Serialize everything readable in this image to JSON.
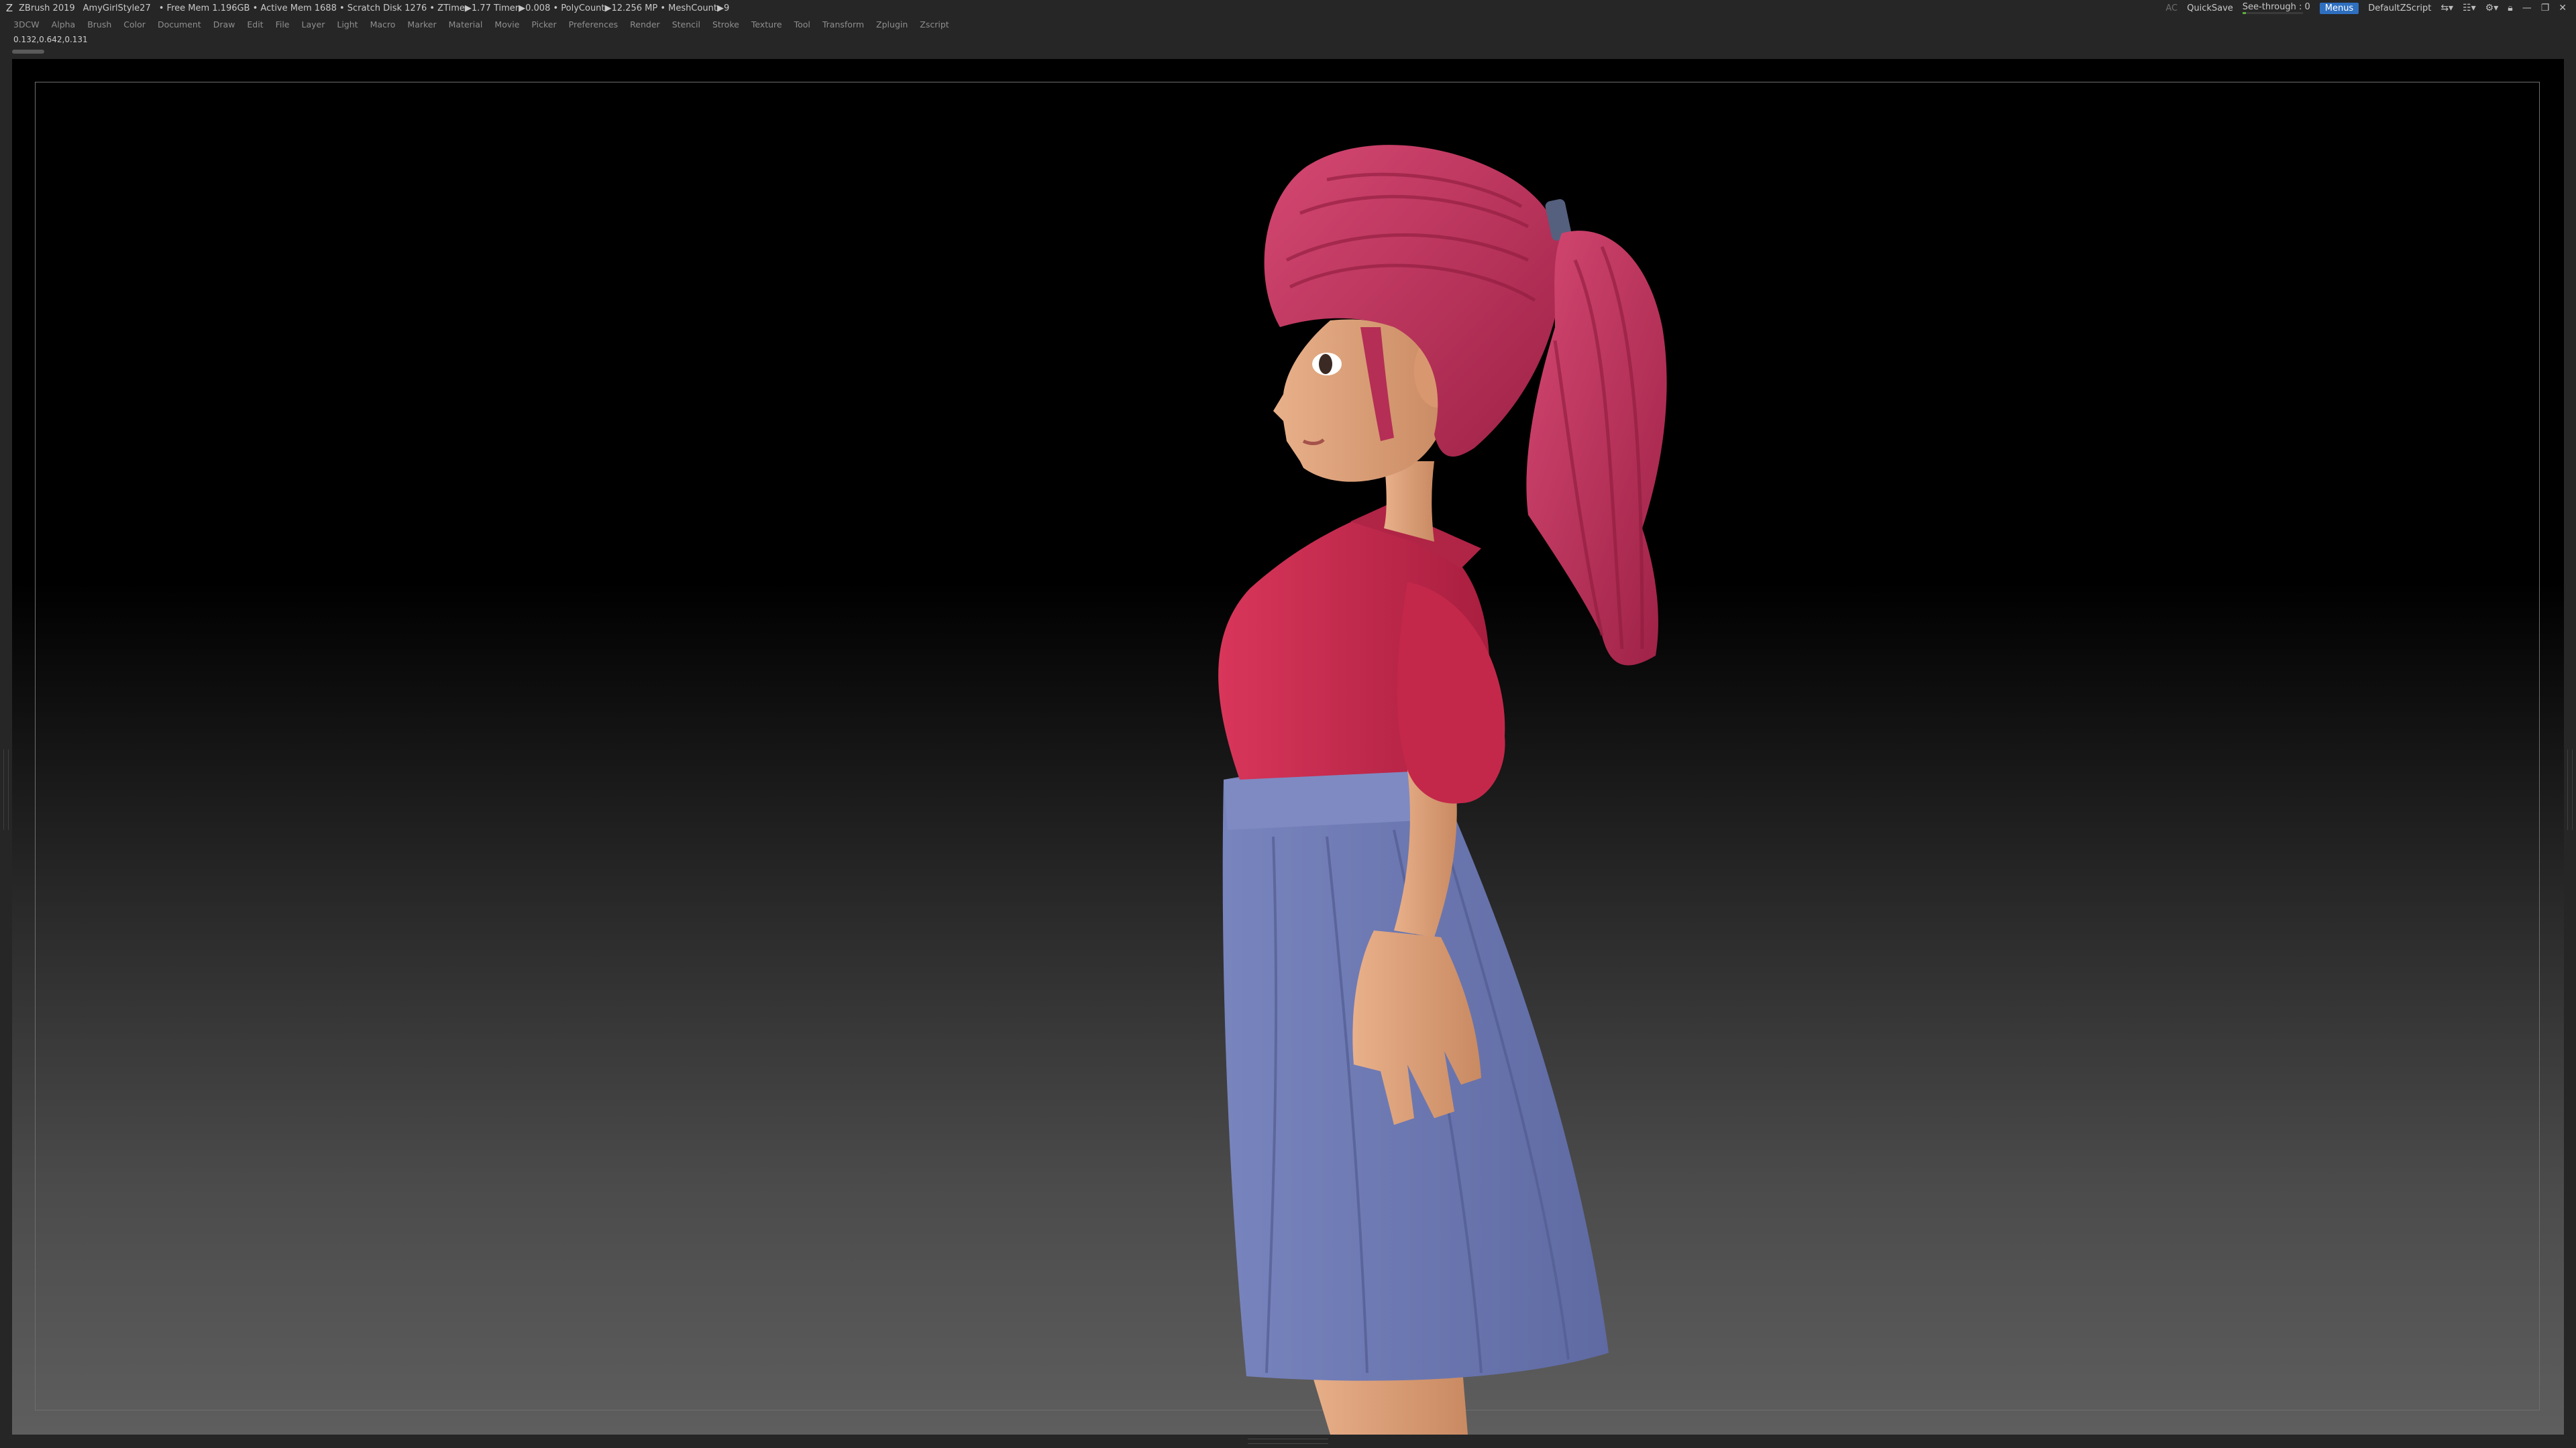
{
  "titlebar": {
    "app": "ZBrush 2019",
    "document": "AmyGirlStyle27",
    "stats": "• Free Mem 1.196GB • Active Mem 1688 • Scratch Disk 1276 • ZTime▶1.77 Timer▶0.008 • PolyCount▶12.256 MP • MeshCount▶9",
    "ac": "AC",
    "quicksave": "QuickSave",
    "see_through": "See-through : 0",
    "see_through_value": 0.05,
    "menus": "Menus",
    "default_zscript": "DefaultZScript"
  },
  "menubar": {
    "items": [
      "3DCW",
      "Alpha",
      "Brush",
      "Color",
      "Document",
      "Draw",
      "Edit",
      "File",
      "Layer",
      "Light",
      "Macro",
      "Marker",
      "Material",
      "Movie",
      "Picker",
      "Preferences",
      "Render",
      "Stencil",
      "Stroke",
      "Texture",
      "Tool",
      "Transform",
      "Zplugin",
      "Zscript"
    ]
  },
  "info": {
    "coords": "0.132,0.642,0.131"
  },
  "colors": {
    "hair": "#c4345c",
    "shirt": "#c92a4b",
    "skirt": "#6e7bb3",
    "skin": "#e3a37c",
    "accent": "#2f6fc0"
  },
  "icons": [
    "zbrush-logo-icon",
    "window-layout-icon",
    "user-interface-icon",
    "lock-icon",
    "minimize-icon",
    "restore-icon",
    "close-icon"
  ]
}
